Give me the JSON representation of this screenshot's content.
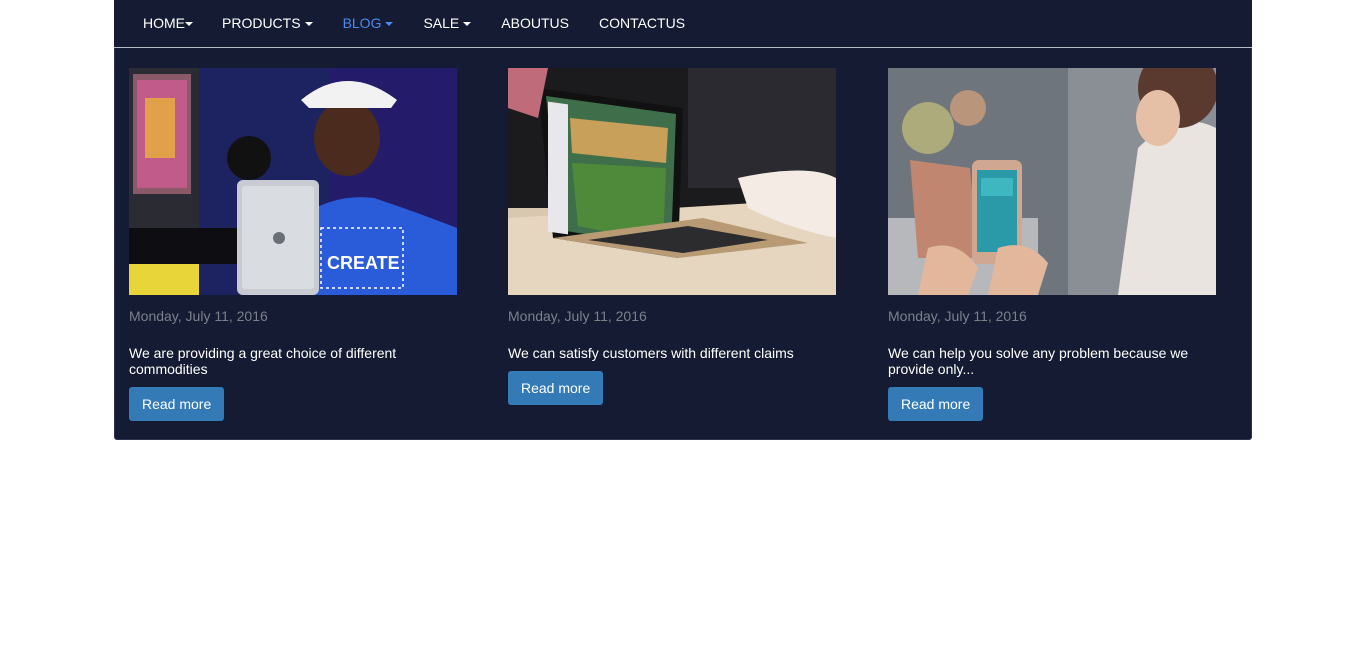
{
  "nav": {
    "items": [
      {
        "label": "HOME",
        "dropdown": true,
        "active": false
      },
      {
        "label": "PRODUCTS",
        "dropdown": true,
        "active": false
      },
      {
        "label": "BLOG",
        "dropdown": true,
        "active": true
      },
      {
        "label": "SALE",
        "dropdown": true,
        "active": false
      },
      {
        "label": "ABOUTUS",
        "dropdown": false,
        "active": false
      },
      {
        "label": "CONTACTUS",
        "dropdown": false,
        "active": false
      }
    ]
  },
  "colors": {
    "navbar_bg": "#141b32",
    "active_link": "#4a8bf0",
    "button": "#337ab7",
    "date_text": "#7c808c"
  },
  "posts": [
    {
      "image": "photo-man-holding-tablet",
      "date": "Monday, July 11, 2016",
      "title": "We are providing a great choice of different commodities",
      "button": "Read more"
    },
    {
      "image": "photo-laptop-on-table",
      "date": "Monday, July 11, 2016",
      "title": "We can satisfy customers with different claims",
      "button": "Read more"
    },
    {
      "image": "photo-woman-holding-smartphone",
      "date": "Monday, July 11, 2016",
      "title": "We can help you solve any problem because we provide only...",
      "button": "Read more"
    }
  ]
}
